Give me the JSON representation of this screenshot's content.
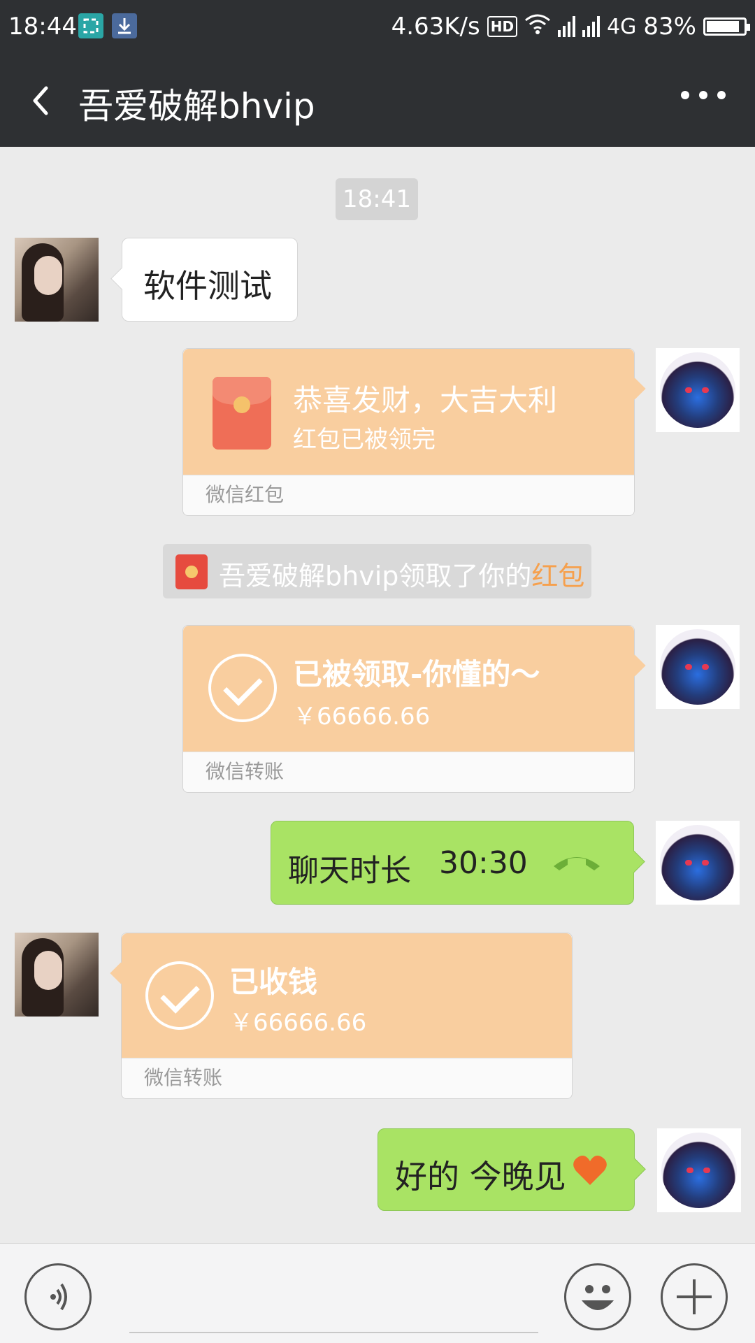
{
  "status_bar": {
    "time": "18:44",
    "speed": "4.63K/s",
    "hd": "HD",
    "network": "4G",
    "battery": "83%",
    "battery_level": 0.83
  },
  "header": {
    "title": "吾爱破解bhvip"
  },
  "chat": {
    "timestamp": "18:41",
    "msg1": "软件测试",
    "red_packet": {
      "title": "恭喜发财，大吉大利",
      "status": "红包已被领完",
      "footer": "微信红包"
    },
    "system_message": {
      "prefix": "吾爱破解bhvip领取了你的",
      "highlight": "红包"
    },
    "transfer1": {
      "title": "已被领取-你懂的～",
      "amount": "￥66666.66",
      "footer": "微信转账"
    },
    "call": {
      "label": "聊天时长",
      "duration": "30:30"
    },
    "transfer2": {
      "title": "已收钱",
      "amount": "￥66666.66",
      "footer": "微信转账"
    },
    "msg_last": "好的 今晚见"
  },
  "colors": {
    "accent": "#f6a04d",
    "card": "#f9ce9f",
    "bubble_green": "#a9e364",
    "header_bg": "#2e3033"
  },
  "icons": [
    "screenshot-icon",
    "download-icon",
    "wifi-icon",
    "signal-icon",
    "battery-icon",
    "back-icon",
    "more-icon",
    "red-packet-icon",
    "check-circle-icon",
    "phone-icon",
    "heart-icon",
    "voice-icon",
    "emoji-icon",
    "plus-icon"
  ]
}
